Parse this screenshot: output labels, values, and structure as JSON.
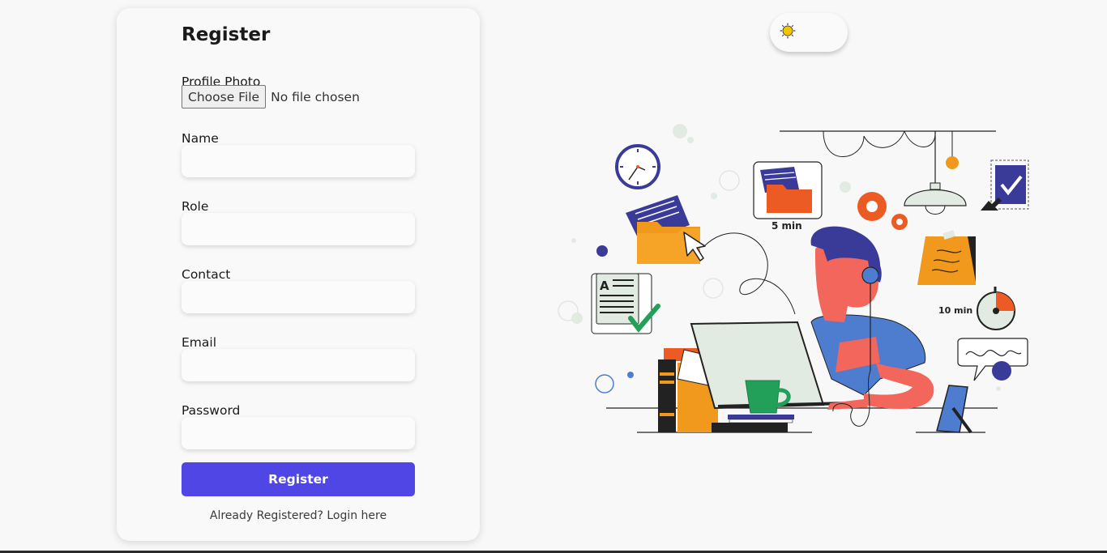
{
  "form": {
    "title": "Register",
    "profile_photo_label": "Profile Photo",
    "choose_file_label": "Choose File",
    "file_status": "No file chosen",
    "name_label": "Name",
    "role_label": "Role",
    "contact_label": "Contact",
    "email_label": "Email",
    "password_label": "Password",
    "submit_label": "Register",
    "login_prompt": "Already Registered? Login here"
  },
  "theme_toggle": {
    "icon": "sun-icon"
  },
  "illustration": {
    "timer_short": "5 min",
    "timer_long": "10 min"
  },
  "colors": {
    "primary": "#4f46e5",
    "orange": "#f0991c",
    "deep_orange": "#ec5b24",
    "navy": "#3a3a98",
    "blue": "#4e7ccf",
    "skin": "#f2665b",
    "green": "#22a05a"
  }
}
